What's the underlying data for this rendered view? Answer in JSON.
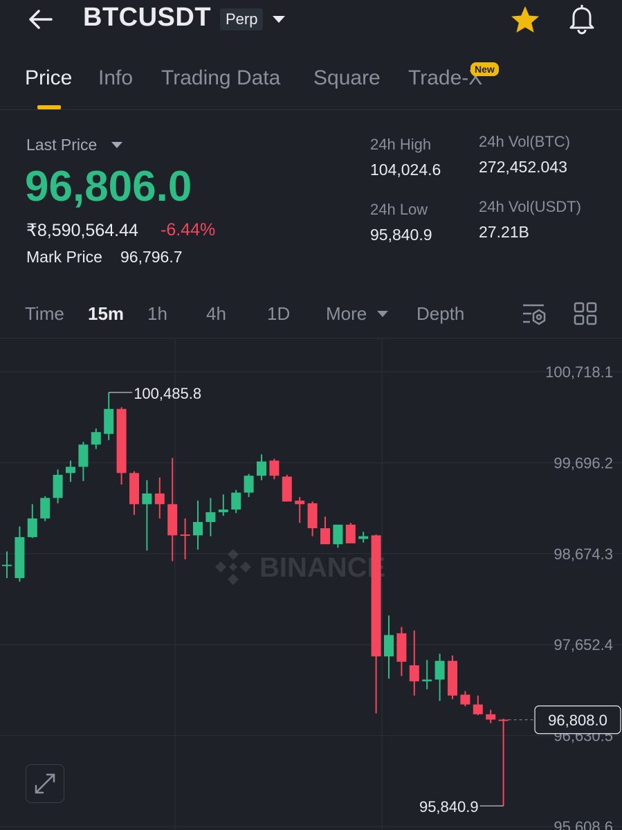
{
  "header": {
    "symbol": "BTCUSDT",
    "contract_type": "Perp",
    "icons": {
      "back": "back-arrow-icon",
      "dropdown": "chevron-down-icon",
      "favorite": "star-icon",
      "alerts": "bell-icon"
    },
    "favorite_color": "#f0b90b"
  },
  "tabs": [
    {
      "label": "Price",
      "active": true
    },
    {
      "label": "Info"
    },
    {
      "label": "Trading Data"
    },
    {
      "label": "Square"
    },
    {
      "label": "Trade-X",
      "badge": "New"
    }
  ],
  "ticker": {
    "last_price_label": "Last Price",
    "last_price": "96,806.0",
    "inr_price": "₹8,590,564.44",
    "change_pct": "-6.44%",
    "mark_price_label": "Mark Price",
    "mark_price": "96,796.7",
    "stats": {
      "high_label": "24h High",
      "high": "104,024.6",
      "low_label": "24h Low",
      "low": "95,840.9",
      "vol_btc_label": "24h Vol(BTC)",
      "vol_btc": "272,452.043",
      "vol_usdt_label": "24h Vol(USDT)",
      "vol_usdt": "27.21B"
    },
    "up_color": "#2ebd85",
    "down_color": "#f6465d"
  },
  "timeframes": {
    "items": [
      "Time",
      "15m",
      "1h",
      "4h",
      "1D",
      "More",
      "Depth"
    ],
    "active": "15m"
  },
  "chart_data": {
    "type": "candlestick",
    "interval": "15m",
    "watermark": "BINANCE",
    "y_ticks": [
      "100,718.1",
      "99,696.2",
      "98,674.3",
      "97,652.4",
      "96,630.5",
      "95,608.6"
    ],
    "ylim": [
      95608.6,
      100718.1
    ],
    "high_label": "100,485.8",
    "low_label": "95,840.9",
    "current_price_label": "96,808.0",
    "current_price": 96808.0,
    "candles": [
      {
        "o": 98550,
        "h": 98700,
        "l": 98400,
        "c": 98550
      },
      {
        "o": 98400,
        "h": 98980,
        "l": 98360,
        "c": 98860
      },
      {
        "o": 98860,
        "h": 99230,
        "l": 98850,
        "c": 99070
      },
      {
        "o": 99070,
        "h": 99320,
        "l": 99040,
        "c": 99300
      },
      {
        "o": 99300,
        "h": 99620,
        "l": 99240,
        "c": 99560
      },
      {
        "o": 99580,
        "h": 99720,
        "l": 99480,
        "c": 99650
      },
      {
        "o": 99650,
        "h": 99930,
        "l": 99490,
        "c": 99900
      },
      {
        "o": 99900,
        "h": 100080,
        "l": 99850,
        "c": 100040
      },
      {
        "o": 100020,
        "h": 100485.8,
        "l": 99950,
        "c": 100300
      },
      {
        "o": 100300,
        "h": 100320,
        "l": 99450,
        "c": 99580
      },
      {
        "o": 99580,
        "h": 99600,
        "l": 99110,
        "c": 99230
      },
      {
        "o": 99230,
        "h": 99500,
        "l": 98710,
        "c": 99350
      },
      {
        "o": 99350,
        "h": 99530,
        "l": 99070,
        "c": 99230
      },
      {
        "o": 99230,
        "h": 99750,
        "l": 98590,
        "c": 98880
      },
      {
        "o": 98890,
        "h": 99070,
        "l": 98610,
        "c": 98880
      },
      {
        "o": 98880,
        "h": 99270,
        "l": 98720,
        "c": 99030
      },
      {
        "o": 99030,
        "h": 99300,
        "l": 98870,
        "c": 99140
      },
      {
        "o": 99140,
        "h": 99340,
        "l": 99100,
        "c": 99170
      },
      {
        "o": 99170,
        "h": 99390,
        "l": 99130,
        "c": 99360
      },
      {
        "o": 99360,
        "h": 99570,
        "l": 99310,
        "c": 99550
      },
      {
        "o": 99550,
        "h": 99790,
        "l": 99500,
        "c": 99710
      },
      {
        "o": 99720,
        "h": 99740,
        "l": 99510,
        "c": 99550
      },
      {
        "o": 99540,
        "h": 99560,
        "l": 99300,
        "c": 99260
      },
      {
        "o": 99270,
        "h": 99310,
        "l": 99020,
        "c": 99230
      },
      {
        "o": 99240,
        "h": 99260,
        "l": 98870,
        "c": 98960
      },
      {
        "o": 98960,
        "h": 99090,
        "l": 98810,
        "c": 98780
      },
      {
        "o": 98780,
        "h": 98990,
        "l": 98740,
        "c": 99000
      },
      {
        "o": 99000,
        "h": 99020,
        "l": 98800,
        "c": 98790
      },
      {
        "o": 98840,
        "h": 98920,
        "l": 98800,
        "c": 98870
      },
      {
        "o": 98880,
        "h": 98890,
        "l": 96880,
        "c": 97520
      },
      {
        "o": 97520,
        "h": 97980,
        "l": 97270,
        "c": 97760
      },
      {
        "o": 97780,
        "h": 97850,
        "l": 97300,
        "c": 97460
      },
      {
        "o": 97420,
        "h": 97810,
        "l": 97080,
        "c": 97240
      },
      {
        "o": 97240,
        "h": 97480,
        "l": 97150,
        "c": 97260
      },
      {
        "o": 97260,
        "h": 97550,
        "l": 97020,
        "c": 97470
      },
      {
        "o": 97470,
        "h": 97530,
        "l": 97040,
        "c": 97080
      },
      {
        "o": 97090,
        "h": 97130,
        "l": 96960,
        "c": 96980
      },
      {
        "o": 96980,
        "h": 97080,
        "l": 96860,
        "c": 96870
      },
      {
        "o": 96870,
        "h": 96920,
        "l": 96770,
        "c": 96810
      },
      {
        "o": 96810,
        "h": 96820,
        "l": 95840.9,
        "c": 96808
      }
    ],
    "candle_last_color_up": true
  }
}
